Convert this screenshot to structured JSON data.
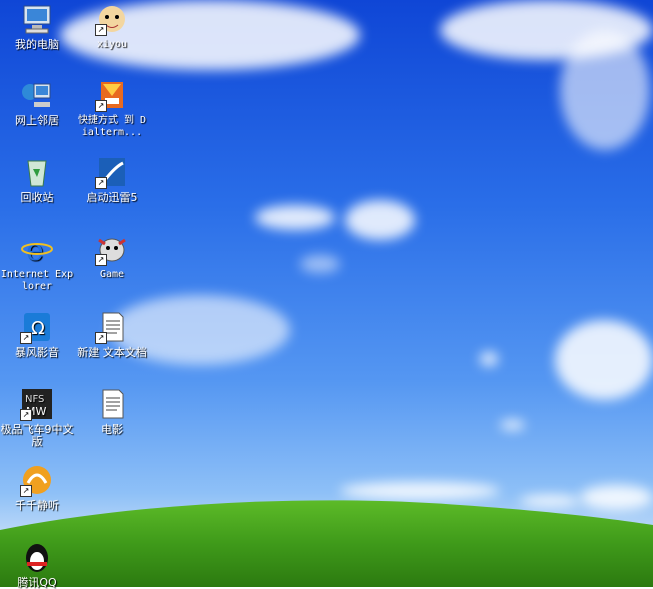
{
  "desktop": {
    "icons": [
      {
        "label": "我的电脑"
      },
      {
        "label": "xiyou"
      },
      {
        "label": "网上邻居"
      },
      {
        "label": "快捷方式 到 Dialterm..."
      },
      {
        "label": "回收站"
      },
      {
        "label": "启动迅雷5"
      },
      {
        "label": "Internet Explorer"
      },
      {
        "label": "Game"
      },
      {
        "label": "暴风影音"
      },
      {
        "label": "新建 文本文档"
      },
      {
        "label": "极品飞车9中文版"
      },
      {
        "label": "电影"
      },
      {
        "label": "千千静听"
      },
      {
        "label": "腾讯QQ"
      }
    ]
  }
}
